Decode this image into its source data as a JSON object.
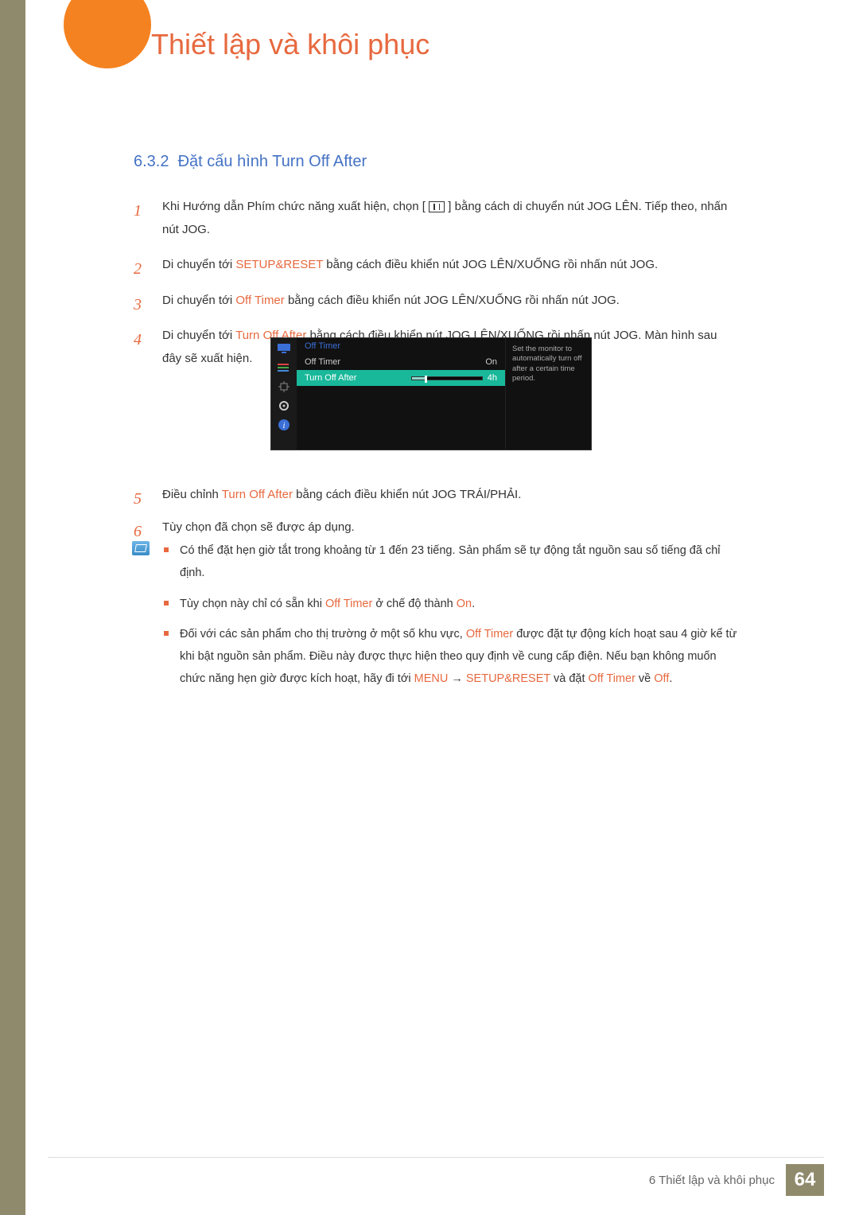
{
  "chapter_title": "Thiết lập và khôi phục",
  "section": {
    "number": "6.3.2",
    "title": "Đặt cấu hình Turn Off After"
  },
  "steps_a": [
    {
      "n": "1",
      "text_a": "Khi Hướng dẫn Phím chức năng xuất hiện, chọn [",
      "text_b": "] bằng cách di chuyển nút JOG LÊN. Tiếp theo, nhấn nút JOG."
    },
    {
      "n": "2",
      "before": "Di chuyển tới ",
      "hl": "SETUP&RESET",
      "after": " bằng cách điều khiển nút JOG LÊN/XUỐNG rồi nhấn nút JOG."
    },
    {
      "n": "3",
      "before": "Di chuyển tới ",
      "hl": "Off Timer",
      "after": " bằng cách điều khiển nút JOG LÊN/XUỐNG rồi nhấn nút JOG."
    },
    {
      "n": "4",
      "before": "Di chuyển tới ",
      "hl": "Turn Off After",
      "after": " bằng cách điều khiển nút JOG LÊN/XUỐNG rồi nhấn nút JOG. Màn hình sau đây sẽ xuất hiện."
    }
  ],
  "osd": {
    "head": "Off Timer",
    "row1_label": "Off Timer",
    "row1_value": "On",
    "row2_label": "Turn Off After",
    "row2_value": "4h",
    "help": "Set the monitor to automatically turn off after a certain time period."
  },
  "steps_b": [
    {
      "n": "5",
      "before": "Điều chỉnh ",
      "hl": "Turn Off After",
      "after": " bằng cách điều khiển nút JOG TRÁI/PHẢI."
    },
    {
      "n": "6",
      "text": "Tùy chọn đã chọn sẽ được áp dụng."
    }
  ],
  "notes": [
    {
      "plain": "Có thể đặt hẹn giờ tắt trong khoảng từ 1 đến 23 tiếng. Sản phẩm sẽ tự động tắt nguồn sau số tiếng đã chỉ định."
    },
    {
      "before": "Tùy chọn này chỉ có sẵn khi ",
      "hl1": "Off Timer",
      "mid": " ở chế độ thành ",
      "hl2": "On",
      "after": "."
    },
    {
      "before": "Đối với các sản phẩm cho thị trường ở một số khu vực, ",
      "hl1": "Off Timer",
      "mid1": " được đặt tự động kích hoạt sau 4 giờ kể từ khi bật nguồn sản phẩm. Điều này được thực hiện theo quy định về cung cấp điện. Nếu bạn không muốn chức năng hẹn giờ được kích hoạt, hãy đi tới ",
      "hl2": "MENU",
      "arrow": " → ",
      "hl3": "SETUP&RESET",
      "mid2": " và đặt ",
      "hl4": "Off Timer",
      "mid3": " về ",
      "hl5": "Off",
      "after": "."
    }
  ],
  "footer": {
    "text": "6 Thiết lập và khôi phục",
    "page": "64"
  }
}
